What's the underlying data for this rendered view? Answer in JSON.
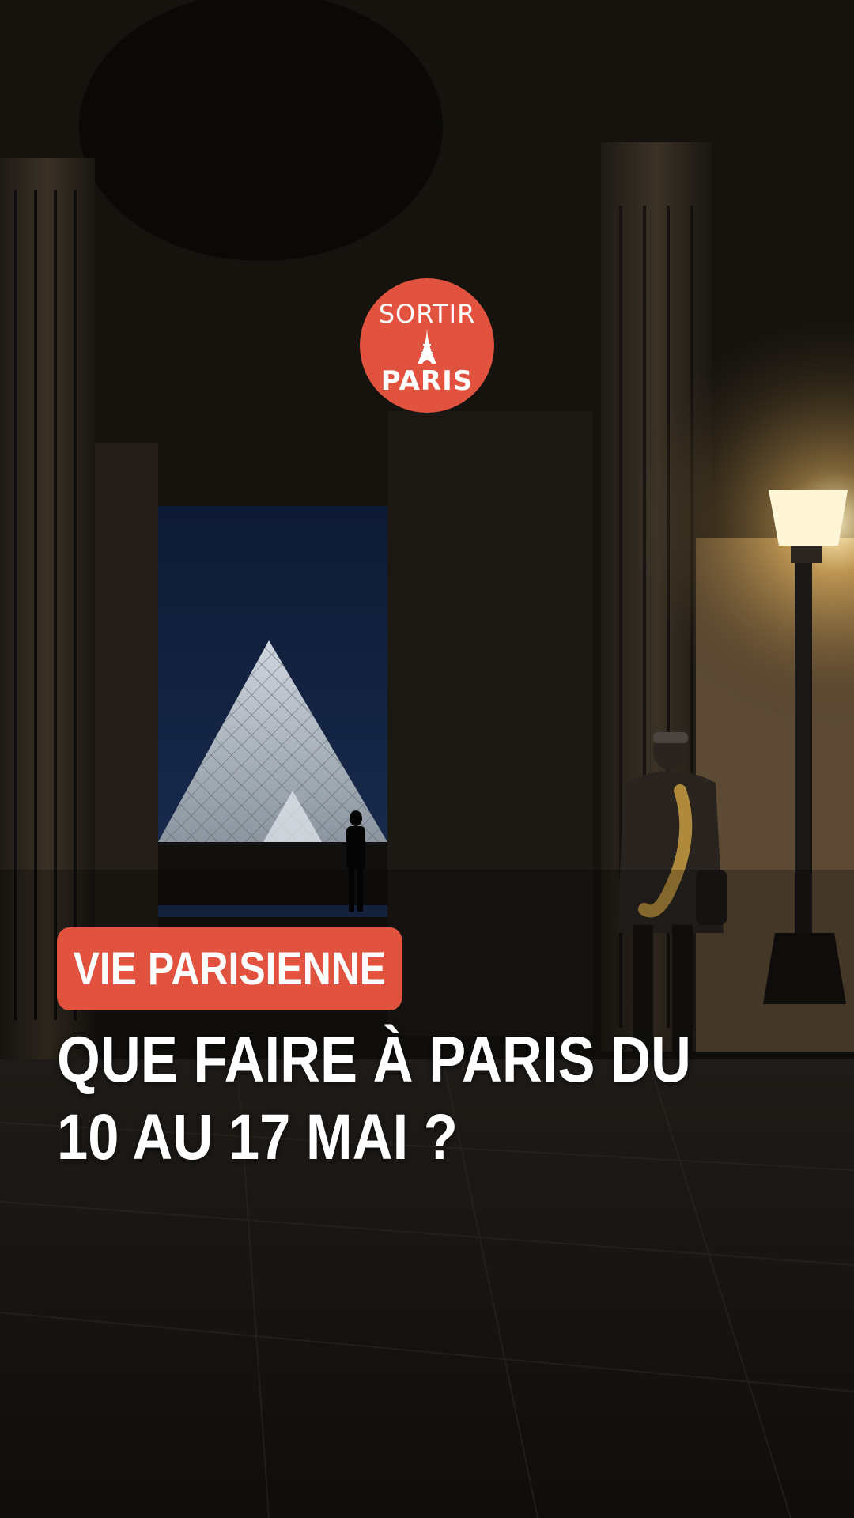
{
  "logo": {
    "line1": "SORTIR",
    "line2": "PARIS",
    "icon": "eiffel-tower-icon",
    "color": "#e2533f"
  },
  "category": {
    "label": "VIE PARISIENNE"
  },
  "headline": {
    "line1": "QUE FAIRE À PARIS DU",
    "line2": "10 AU 17 MAI ?"
  },
  "colors": {
    "accent": "#e2533f",
    "text": "#ffffff"
  }
}
